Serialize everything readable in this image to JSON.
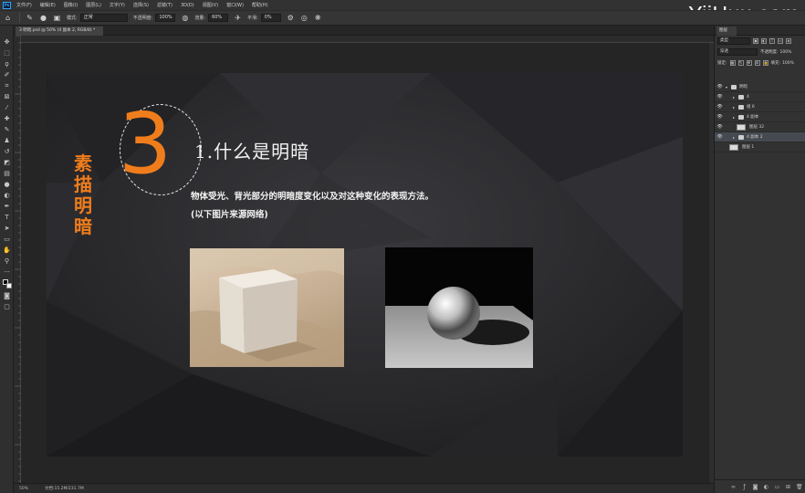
{
  "menubar": {
    "items": [
      "文件(F)",
      "编辑(E)",
      "图像(I)",
      "图层(L)",
      "文字(Y)",
      "选择(S)",
      "滤镜(T)",
      "3D(D)",
      "视图(V)",
      "窗口(W)",
      "帮助(H)"
    ]
  },
  "watermark": "YiiHuu.com",
  "options": {
    "mode_label": "模式:",
    "mode_value": "正常",
    "opacity_label": "不透明度:",
    "opacity_value": "100%",
    "flow_label": "流量:",
    "flow_value": "60%",
    "smooth_label": "平滑:",
    "smooth_value": "0%"
  },
  "document": {
    "tab_label": "3 明暗.psd @ 50% (4 副本 2, RGB/8) *"
  },
  "slide": {
    "number": "3",
    "vertical_title": "素描明暗",
    "heading": "1.什么是明暗",
    "description": "物体受光、背光部分的明暗度变化以及对这种变化的表现方法。",
    "source_note": "(以下图片来源网络)"
  },
  "status": {
    "zoom": "50%",
    "doc_info": "文档:15.2M/231.7M"
  },
  "layers_panel": {
    "tab": "图层",
    "kind_filter": "类型",
    "blend_mode": "穿透",
    "opacity_label": "不透明度:",
    "opacity_value": "100%",
    "lock_label": "锁定:",
    "fill_label": "填充:",
    "fill_value": "100%",
    "layers": [
      {
        "name": "明暗",
        "type": "group",
        "indent": 0,
        "expanded": true,
        "selected": false
      },
      {
        "name": "4",
        "type": "group",
        "indent": 1,
        "expanded": false,
        "selected": false
      },
      {
        "name": "组 6",
        "type": "group",
        "indent": 1,
        "expanded": false,
        "selected": false
      },
      {
        "name": "4 副本",
        "type": "group",
        "indent": 1,
        "expanded": false,
        "selected": false
      },
      {
        "name": "图层 32",
        "type": "pixel",
        "indent": 1,
        "expanded": false,
        "selected": false
      },
      {
        "name": "4 副本 2",
        "type": "group",
        "indent": 1,
        "expanded": false,
        "selected": true
      },
      {
        "name": "图层 1",
        "type": "pixel",
        "indent": 0,
        "expanded": false,
        "selected": false
      }
    ]
  },
  "icons": {
    "toolbar": [
      "move-icon",
      "marquee-icon",
      "lasso-icon",
      "quick-select-icon",
      "crop-icon",
      "frame-icon",
      "eyedropper-icon",
      "healing-icon",
      "brush-icon",
      "stamp-icon",
      "history-brush-icon",
      "eraser-icon",
      "gradient-icon",
      "blur-icon",
      "dodge-icon",
      "pen-icon",
      "type-icon",
      "path-select-icon",
      "shape-icon",
      "hand-icon",
      "zoom-icon",
      "more-icon",
      "color-swatch-icon",
      "quick-mask-icon",
      "screen-mode-icon"
    ]
  }
}
